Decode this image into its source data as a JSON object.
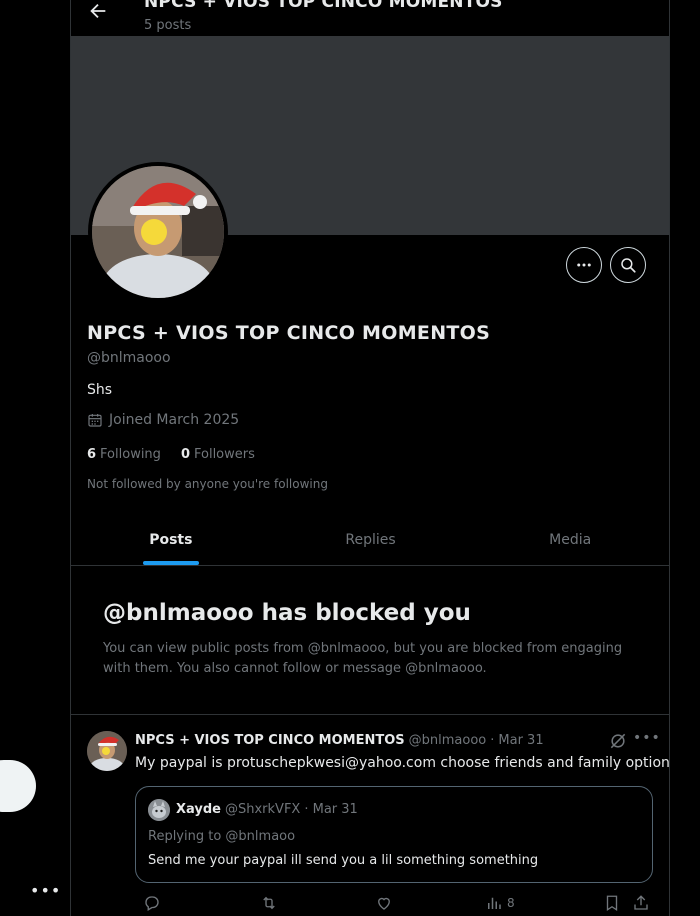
{
  "header": {
    "title": "NPCS + VIOS TOP CINCO MOMENTOS",
    "post_count": "5 posts"
  },
  "profile": {
    "display_name": "NPCS + VIOS TOP CINCO MOMENTOS",
    "handle": "@bnlmaooo",
    "bio": "Shs",
    "joined": "Joined March 2025",
    "following_count": "6",
    "following_label": "Following",
    "followers_count": "0",
    "followers_label": "Followers",
    "not_followed_note": "Not followed by anyone you're following"
  },
  "tabs": [
    {
      "label": "Posts",
      "active": true
    },
    {
      "label": "Replies",
      "active": false
    },
    {
      "label": "Media",
      "active": false
    }
  ],
  "blocked": {
    "title": "@bnlmaooo has blocked you",
    "text": "You can view public posts from @bnlmaooo, but you are blocked from engaging with them. You also cannot follow or message @bnlmaooo."
  },
  "tweet": {
    "name": "NPCS + VIOS TOP CINCO MOMENTOS",
    "handle": "@bnlmaooo",
    "separator": "·",
    "date": "Mar 31",
    "text": "My paypal is protuschepkwesi@yahoo.com choose friends and family option",
    "quote": {
      "name": "Xayde",
      "handle": "@ShxrkVFX",
      "date": "· Mar 31",
      "replying_to": "Replying to @bnlmaoo",
      "text": "Send me your paypal ill send you a lil something something"
    },
    "views": "8"
  },
  "colors": {
    "background": "#000000",
    "banner": "#333639",
    "border": "#2f3336",
    "muted_text": "#71767b",
    "accent": "#1d9bf0"
  },
  "icons": {
    "back": "back-arrow-icon",
    "more": "more-horizontal-icon",
    "search": "search-icon",
    "calendar": "calendar-icon",
    "grok": "grok-icon",
    "reply": "reply-icon",
    "repost": "repost-icon",
    "like": "like-icon",
    "views": "views-icon",
    "bookmark": "bookmark-icon",
    "share": "share-icon"
  }
}
